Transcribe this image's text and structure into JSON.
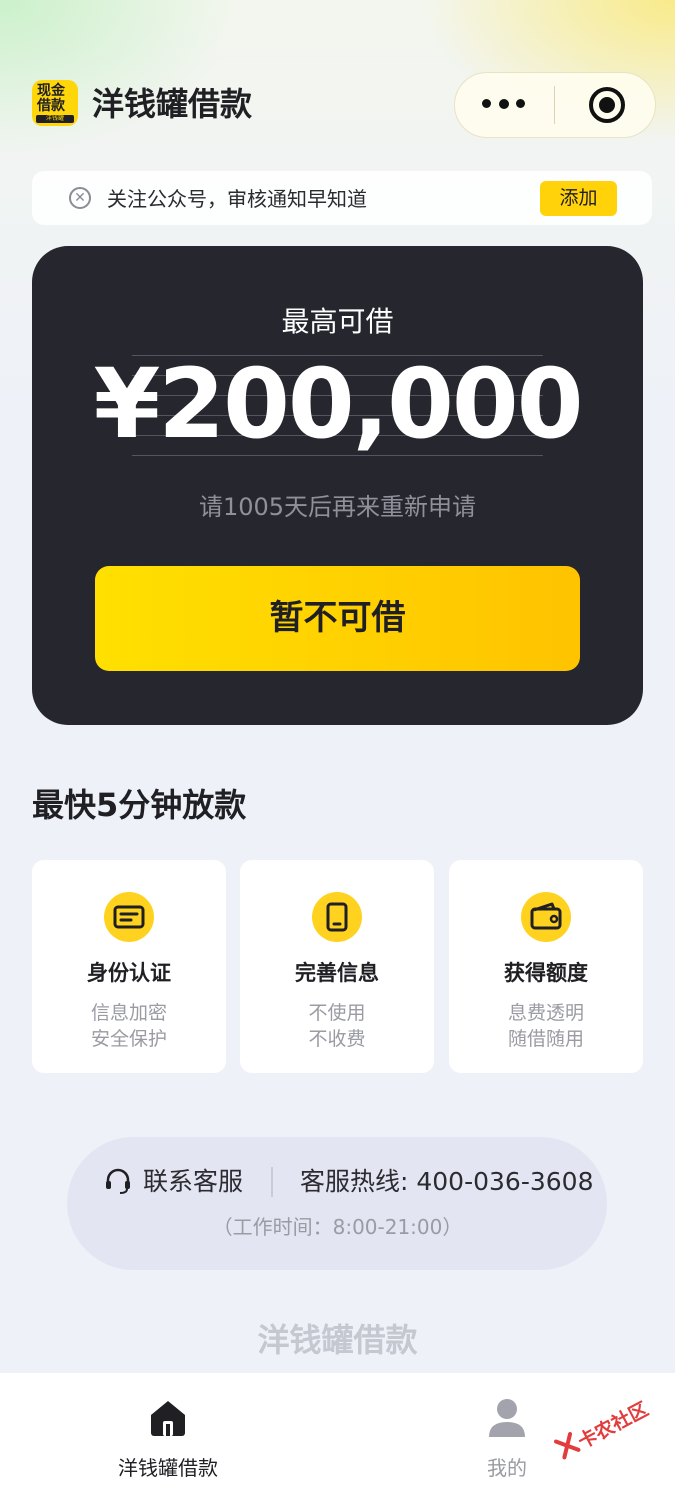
{
  "header": {
    "logo_line1": "现金",
    "logo_line2": "借款",
    "logo_line3": "洋钱罐",
    "app_title": "洋钱罐借款"
  },
  "notice": {
    "text": "关注公众号，审核通知早知道",
    "button": "添加"
  },
  "card": {
    "label": "最高可借",
    "amount": "¥200,000",
    "reapply": "请1005天后再来重新申请",
    "cta": "暂不可借"
  },
  "section": {
    "title": "最快5分钟放款",
    "features": [
      {
        "icon": "id-card-icon",
        "title": "身份认证",
        "line1": "信息加密",
        "line2": "安全保护"
      },
      {
        "icon": "phone-icon",
        "title": "完善信息",
        "line1": "不使用",
        "line2": "不收费"
      },
      {
        "icon": "wallet-icon",
        "title": "获得额度",
        "line1": "息费透明",
        "line2": "随借随用"
      }
    ]
  },
  "service": {
    "contact": "联系客服",
    "hotline": "客服热线: 400-036-3608",
    "hours": "（工作时间：8:00-21:00）"
  },
  "footer_brand": "洋钱罐借款",
  "tabbar": {
    "home": "洋钱罐借款",
    "me": "我的"
  },
  "watermark": "卡农社区",
  "colors": {
    "accent": "#ffd20a",
    "card_bg": "#26262e",
    "page_bg": "#eef1f8"
  }
}
